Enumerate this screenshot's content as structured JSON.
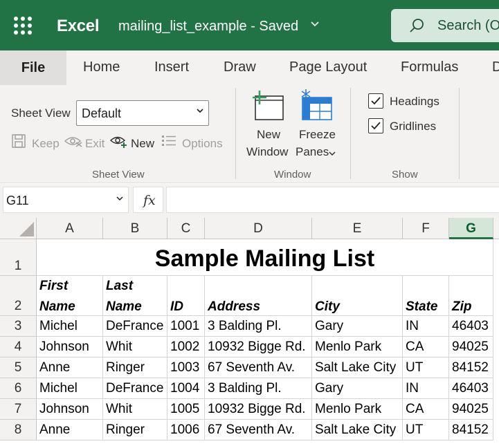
{
  "header": {
    "app_name": "Excel",
    "doc_title": "mailing_list_example  -  Saved",
    "search_placeholder": "Search (O"
  },
  "tabs": [
    "File",
    "Home",
    "Insert",
    "Draw",
    "Page Layout",
    "Formulas",
    "D"
  ],
  "ribbon": {
    "sheet_view_label": "Sheet View",
    "sheet_view_value": "Default",
    "keep": "Keep",
    "exit": "Exit",
    "new": "New",
    "options": "Options",
    "group_sheet_view": "Sheet View",
    "new_window_1": "New",
    "new_window_2": "Window",
    "freeze_1": "Freeze",
    "freeze_2": "Panes",
    "group_window": "Window",
    "headings": "Headings",
    "gridlines": "Gridlines",
    "group_show": "Show"
  },
  "formula_bar": {
    "name_box": "G11",
    "fx": "fx",
    "formula": ""
  },
  "grid": {
    "columns": [
      "A",
      "B",
      "C",
      "D",
      "E",
      "F",
      "G"
    ],
    "active_column": "G",
    "rows": [
      "1",
      "2",
      "3",
      "4",
      "5",
      "6",
      "7",
      "8"
    ],
    "title": "Sample Mailing List",
    "header_row": {
      "first_1": "First",
      "first_2": "Name",
      "last_1": "Last",
      "last_2": "Name",
      "id": "ID",
      "address": "Address",
      "city": "City",
      "state": "State",
      "zip": "Zip"
    },
    "data": [
      [
        "Michel",
        "DeFrance",
        "1001",
        "3 Balding Pl.",
        "Gary",
        "IN",
        "46403"
      ],
      [
        "Johnson",
        "Whit",
        "1002",
        "10932 Bigge Rd.",
        "Menlo Park",
        "CA",
        "94025"
      ],
      [
        "Anne",
        "Ringer",
        "1003",
        "67 Seventh Av.",
        "Salt Lake City",
        "UT",
        "84152"
      ],
      [
        "Michel",
        "DeFrance",
        "1004",
        "3 Balding Pl.",
        "Gary",
        "IN",
        "46403"
      ],
      [
        "Johnson",
        "Whit",
        "1005",
        "10932 Bigge Rd.",
        "Menlo Park",
        "CA",
        "94025"
      ],
      [
        "Anne",
        "Ringer",
        "1006",
        "67 Seventh Av.",
        "Salt Lake City",
        "UT",
        "84152"
      ]
    ]
  },
  "colors": {
    "brand": "#217346",
    "ribbon_bg": "#f3f2f1",
    "search_bg": "#d6e8dd"
  }
}
